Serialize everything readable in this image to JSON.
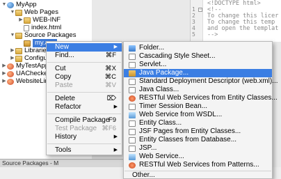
{
  "tree": {
    "rows": [
      {
        "label": "MyApp",
        "icon": "globe-icon"
      },
      {
        "label": "Web Pages",
        "icon": "folder-icon"
      },
      {
        "label": "WEB-INF",
        "icon": "folder-icon"
      },
      {
        "label": "index.html",
        "icon": "html-file-icon"
      },
      {
        "label": "Source Packages",
        "icon": "folder-icon"
      },
      {
        "label": "my.a…",
        "icon": "package-icon"
      },
      {
        "label": "Librarie",
        "icon": "folder-icon"
      },
      {
        "label": "Configur",
        "icon": "folder-icon"
      },
      {
        "label": "MyTestApp",
        "icon": "project-icon"
      },
      {
        "label": "UAChecker",
        "icon": "project-icon"
      },
      {
        "label": "WebsiteLink",
        "icon": "project-icon"
      }
    ]
  },
  "status_text": "Source Packages - M",
  "editor": {
    "lines": [
      {
        "num": "",
        "text": "<!DOCTYPE html>"
      },
      {
        "num": "1",
        "text": "<!--"
      },
      {
        "num": "2",
        "text": "To change this licer"
      },
      {
        "num": "3",
        "text": "To change this temp"
      },
      {
        "num": "4",
        "text": "and open the templat"
      },
      {
        "num": "5",
        "text": "-->"
      }
    ]
  },
  "context_menu": {
    "new": "New",
    "find": "Find...",
    "find_sc": "⌘F",
    "cut": "Cut",
    "cut_sc": "⌘X",
    "copy": "Copy",
    "copy_sc": "⌘C",
    "paste": "Paste",
    "paste_sc": "⌘V",
    "delete": "Delete",
    "delete_sc": "⌦",
    "refactor": "Refactor",
    "compile": "Compile Package",
    "compile_sc": "F9",
    "test": "Test Package",
    "test_sc": "⌘F6",
    "history": "History",
    "tools": "Tools"
  },
  "submenu": {
    "items": [
      {
        "label": "Folder...",
        "icon": "folder-icon"
      },
      {
        "label": "Cascading Style Sheet...",
        "icon": "css-file-icon"
      },
      {
        "label": "Servlet...",
        "icon": "servlet-icon"
      },
      {
        "label": "Java Package...",
        "icon": "java-package-icon"
      },
      {
        "label": "Standard Deployment Descriptor (web.xml)...",
        "icon": "xml-file-icon"
      },
      {
        "label": "Java Class...",
        "icon": "java-class-icon"
      },
      {
        "label": "RESTful Web Services from Entity Classes...",
        "icon": "rest-service-icon"
      },
      {
        "label": "Timer Session Bean...",
        "icon": "timer-bean-icon"
      },
      {
        "label": "Web Service from WSDL...",
        "icon": "web-service-icon"
      },
      {
        "label": "Entity Class...",
        "icon": "entity-class-icon"
      },
      {
        "label": "JSF Pages from Entity Classes...",
        "icon": "jsf-pages-icon"
      },
      {
        "label": "Entity Classes from Database...",
        "icon": "database-entity-icon"
      },
      {
        "label": "JSP...",
        "icon": "jsp-file-icon"
      },
      {
        "label": "Web Service...",
        "icon": "web-service-icon"
      },
      {
        "label": "RESTful Web Services from Patterns...",
        "icon": "rest-service-icon"
      },
      {
        "label": "Other...",
        "icon": ""
      }
    ]
  },
  "colors": {
    "highlight": "#3b7ee3",
    "tree_selection": "#3d79d6"
  }
}
